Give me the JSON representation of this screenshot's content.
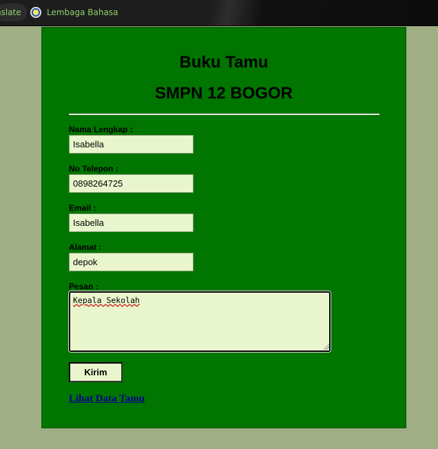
{
  "browser": {
    "bookmarks": [
      {
        "label": "nslate"
      },
      {
        "label": "Lembaga Bahasa"
      }
    ]
  },
  "form": {
    "title": "Buku Tamu",
    "subtitle": "SMPN 12 BOGOR",
    "fields": {
      "nama": {
        "label": "Nama Lengkap :",
        "value": "Isabella"
      },
      "telepon": {
        "label": "No Telepon :",
        "value": "0898264725"
      },
      "email": {
        "label": "Email :",
        "value": "Isabella"
      },
      "alamat": {
        "label": "Alamat :",
        "value": "depok"
      },
      "pesan": {
        "label": "Pesan :",
        "value": "Kepala Sekolah"
      }
    },
    "submit_label": "Kirim",
    "view_link": "Lihat Data Tamu"
  }
}
